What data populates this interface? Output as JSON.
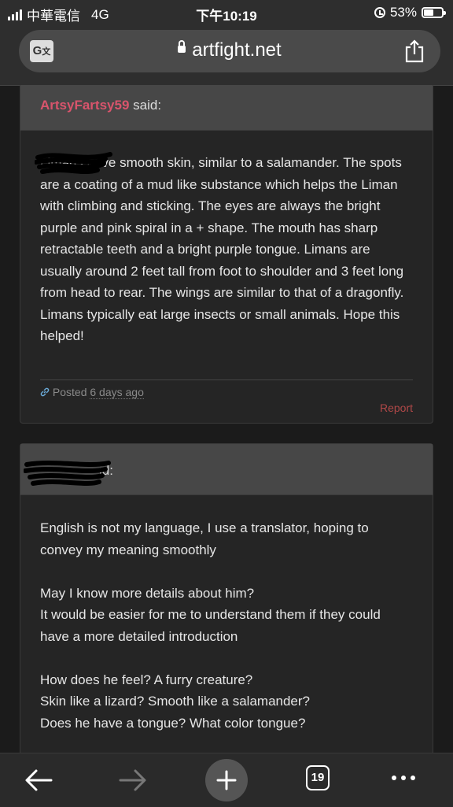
{
  "status": {
    "carrier": "中華電信",
    "network": "4G",
    "time": "下午10:19",
    "battery": "53%",
    "battery_level": 0.53
  },
  "browser": {
    "url": "artfight.net",
    "tab_count": "19"
  },
  "posts": [
    {
      "author": "ArtsyFartsy59",
      "said": "said:",
      "paragraphs": [
        "Limans have smooth skin, similar to a salamander. The spots are a coating of a mud like substance which helps the Liman with climbing and sticking. The eyes are always the bright purple and pink spiral in a + shape. The mouth has sharp retractable teeth and a bright purple tongue. Limans are usually around 2 feet tall from foot to shoulder and 3 feet long from head to rear. The wings are similar to that of a dragonfly. Limans typically eat large insects or small animals. Hope this helped!"
      ],
      "posted_label": "Posted",
      "posted_when": "6 days ago",
      "report": "Report"
    },
    {
      "author": "",
      "said": "said:",
      "paragraphs": [
        "English is not my language, I use a translator, hoping to convey my meaning smoothly",
        "May I know more details about him?\nIt would be easier for me to understand them if they could have a more detailed introduction",
        "How does he feel? A furry creature?\nSkin like a lizard? Smooth like a salamander?\nDoes he have a tongue? What color tongue?"
      ]
    }
  ],
  "icons": {
    "translate": "translate-icon",
    "lock": "lock-icon",
    "share": "share-icon",
    "back": "back-arrow-icon",
    "forward": "forward-arrow-icon",
    "new_tab": "plus-icon",
    "tabs": "tabs-icon",
    "more": "more-dots-icon",
    "link": "link-icon"
  }
}
